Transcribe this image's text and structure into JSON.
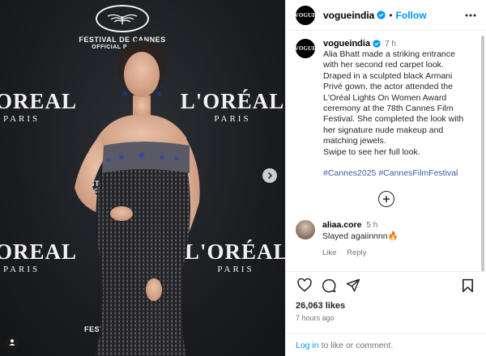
{
  "post": {
    "image_alt": "Alia Bhatt at the L'Oréal Lights On Women Award in Cannes",
    "backdrop": {
      "brand_word": "L'ORÉAL",
      "brand_word_partial": "OREAL",
      "brand_sub": "PARIS",
      "festival_line1": "FESTIVAL DE CANNES",
      "festival_line2": "OFFICIAL PARTNER",
      "festival_line1_partial": "FESTIVA",
      "festival_line2_partial": "OFFICIA",
      "festival_bottom": "FESTIVA"
    }
  },
  "header": {
    "username": "vogueindia",
    "avatar_text": "VOGUE",
    "follow_label": "Follow"
  },
  "caption": {
    "username": "vogueindia",
    "time": "7 h",
    "text": "Alia Bhatt made a striking entrance\nwith her second red carpet look.\nDraped in a sculpted black Armani\nPrivé gown, the actor attended the\nL'Oréal Lights On Women Award\nceremony at the 78th Cannes Film\nFestival. She completed the look with\nher signature nude makeup and\nmatching jewels.\nSwipe to see her full look.",
    "hashtags": [
      "#Cannes2025",
      "#CannesFilmFestival"
    ]
  },
  "comments": [
    {
      "username": "aliaa.core",
      "time": "5 h",
      "text": "Slayed agaiinnnn🔥",
      "like_label": "Like",
      "reply_label": "Reply"
    }
  ],
  "stats": {
    "likes": "26,063 likes",
    "posted": "7 hours ago"
  },
  "footer": {
    "login_link": "Log in",
    "login_text": "to like or comment."
  },
  "colors": {
    "accent": "#0095f6",
    "verified": "#0095f6",
    "hashtag": "#3b5ea8"
  }
}
